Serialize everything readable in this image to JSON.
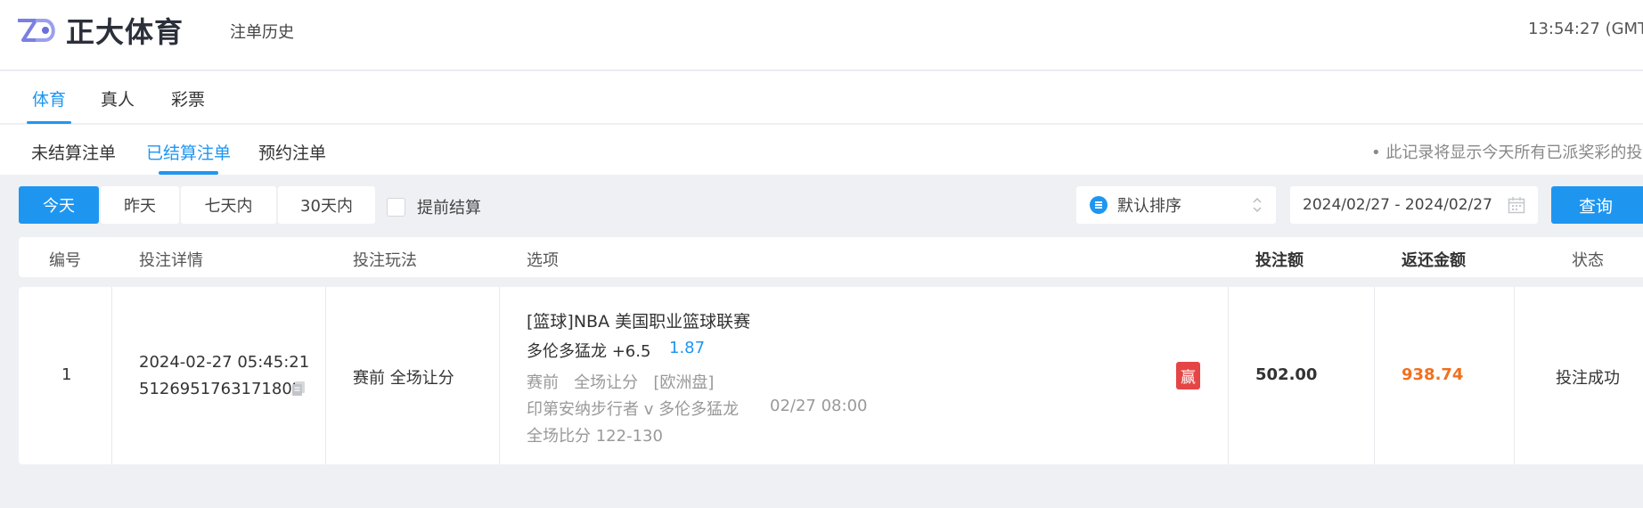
{
  "header": {
    "logo_text": "正大体育",
    "page_heading": "注单历史",
    "clock": "13:54:27 (GMT+"
  },
  "category_tabs": [
    {
      "label": "体育",
      "active": true
    },
    {
      "label": "真人",
      "active": false
    },
    {
      "label": "彩票",
      "active": false
    }
  ],
  "sub_tabs": [
    {
      "label": "未结算注单",
      "active": false
    },
    {
      "label": "已结算注单",
      "active": true
    },
    {
      "label": "预约注单",
      "active": false
    }
  ],
  "notice": "• 此记录将显示今天所有已派奖彩的投",
  "filters": {
    "ranges": [
      {
        "label": "今天",
        "active": true
      },
      {
        "label": "昨天",
        "active": false
      },
      {
        "label": "七天内",
        "active": false
      },
      {
        "label": "30天内",
        "active": false
      }
    ],
    "early_settle_label": "提前结算",
    "early_settle_checked": false,
    "sort_label": "默认排序",
    "date_range": "2024/02/27 - 2024/02/27",
    "query_label": "查询"
  },
  "table": {
    "headers": {
      "no": "编号",
      "detail": "投注详情",
      "play": "投注玩法",
      "selection": "选项",
      "stake": "投注额",
      "return": "返还金额",
      "status": "状态"
    },
    "rows": [
      {
        "no": "1",
        "datetime": "2024-02-27 05:45:21",
        "bet_id": "5126951763171802",
        "play": "赛前 全场让分",
        "league": "[篮球]NBA 美国职业篮球联赛",
        "pick": "多伦多猛龙 +6.5",
        "odds": "1.87",
        "market": "赛前   全场让分   [欧洲盘]",
        "match": "印第安纳步行者 v 多伦多猛龙",
        "match_time": "02/27 08:00",
        "score": "全场比分 122-130",
        "result_badge": "赢",
        "stake": "502.00",
        "return": "938.74",
        "status": "投注成功"
      }
    ]
  },
  "colors": {
    "accent": "#1e96f0",
    "win": "#e54545",
    "payout": "#f07020",
    "background": "#eef0f4"
  }
}
